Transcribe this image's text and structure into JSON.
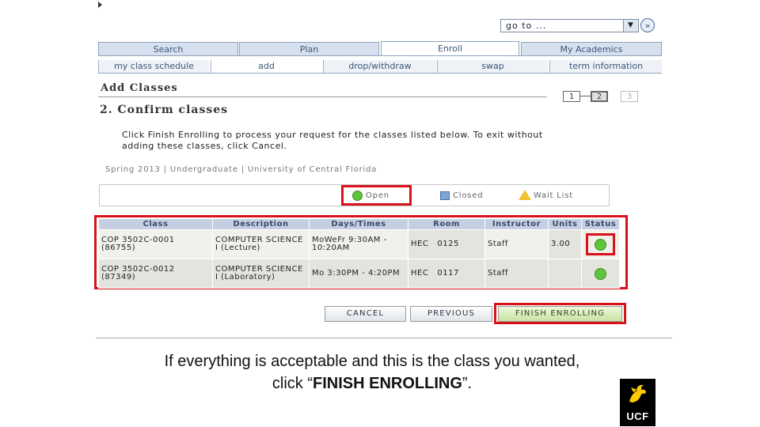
{
  "goto": {
    "value": "go to ...",
    "go_symbol": "»"
  },
  "tabs": [
    "Search",
    "Plan",
    "Enroll",
    "My Academics"
  ],
  "subtabs": [
    "my class schedule",
    "add",
    "drop/withdraw",
    "swap",
    "term information"
  ],
  "heading": "Add Classes",
  "step_title": "2.  Confirm classes",
  "steps": [
    "1",
    "2",
    "3"
  ],
  "instructions": "Click Finish Enrolling to process your request for the classes listed below. To exit without adding these classes, click Cancel.",
  "term": "Spring 2013 | Undergraduate | University of Central Florida",
  "legend": {
    "open": "Open",
    "closed": "Closed",
    "wait": "Wait List"
  },
  "table": {
    "headers": [
      "Class",
      "Description",
      "Days/Times",
      "Room",
      "Instructor",
      "Units",
      "Status"
    ],
    "rows": [
      {
        "class": "COP 3502C-0001 (86755)",
        "desc": "COMPUTER SCIENCE I (Lecture)",
        "days": "MoWeFr 9:30AM - 10:20AM",
        "room": "HEC   0125",
        "instructor": "Staff",
        "units": "3.00",
        "status": "Open"
      },
      {
        "class": "COP 3502C-0012 (87349)",
        "desc": "COMPUTER SCIENCE I (Laboratory)",
        "days": "Mo 3:30PM - 4:20PM",
        "room": "HEC   0117",
        "instructor": "Staff",
        "units": "",
        "status": "Open"
      }
    ]
  },
  "buttons": {
    "cancel": "CANCEL",
    "previous": "PREVIOUS",
    "finish": "FINISH ENROLLING"
  },
  "caption": {
    "line1": "If everything is  acceptable and this is the class you wanted,",
    "line2_pre": "click “",
    "line2_bold": "FINISH ENROLLING",
    "line2_post": "”."
  },
  "logo": {
    "text": "UCF"
  },
  "colors": {
    "open_green": "#5cc63a",
    "highlight_red": "#d8121a",
    "tab_blue": "#d7e1ee",
    "logo_gold": "#ffc904"
  }
}
